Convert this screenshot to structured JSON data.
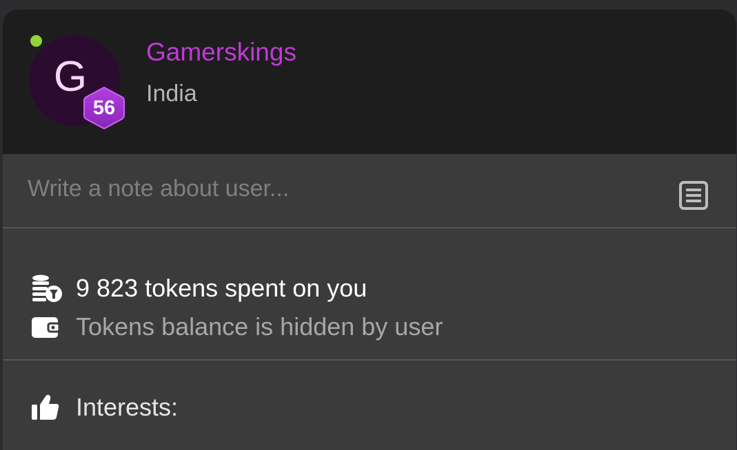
{
  "profile": {
    "avatar_letter": "G",
    "level": "56",
    "username": "Gamerskings",
    "country": "India",
    "online": true
  },
  "note": {
    "placeholder": "Write a note about user...",
    "value": "",
    "icon": "note-icon"
  },
  "stats": {
    "spent": "9 823 tokens spent on you",
    "balance": "Tokens balance is hidden by user",
    "spent_icon": "coins-icon",
    "balance_icon": "wallet-icon"
  },
  "interests": {
    "label": "Interests:",
    "icon": "thumbs-up-icon"
  },
  "colors": {
    "username": "#c03ad8",
    "online": "#93d43a",
    "badge": "#9b2fc4",
    "header_bg": "#1d1d1d",
    "body_bg": "#3b3b3b"
  }
}
